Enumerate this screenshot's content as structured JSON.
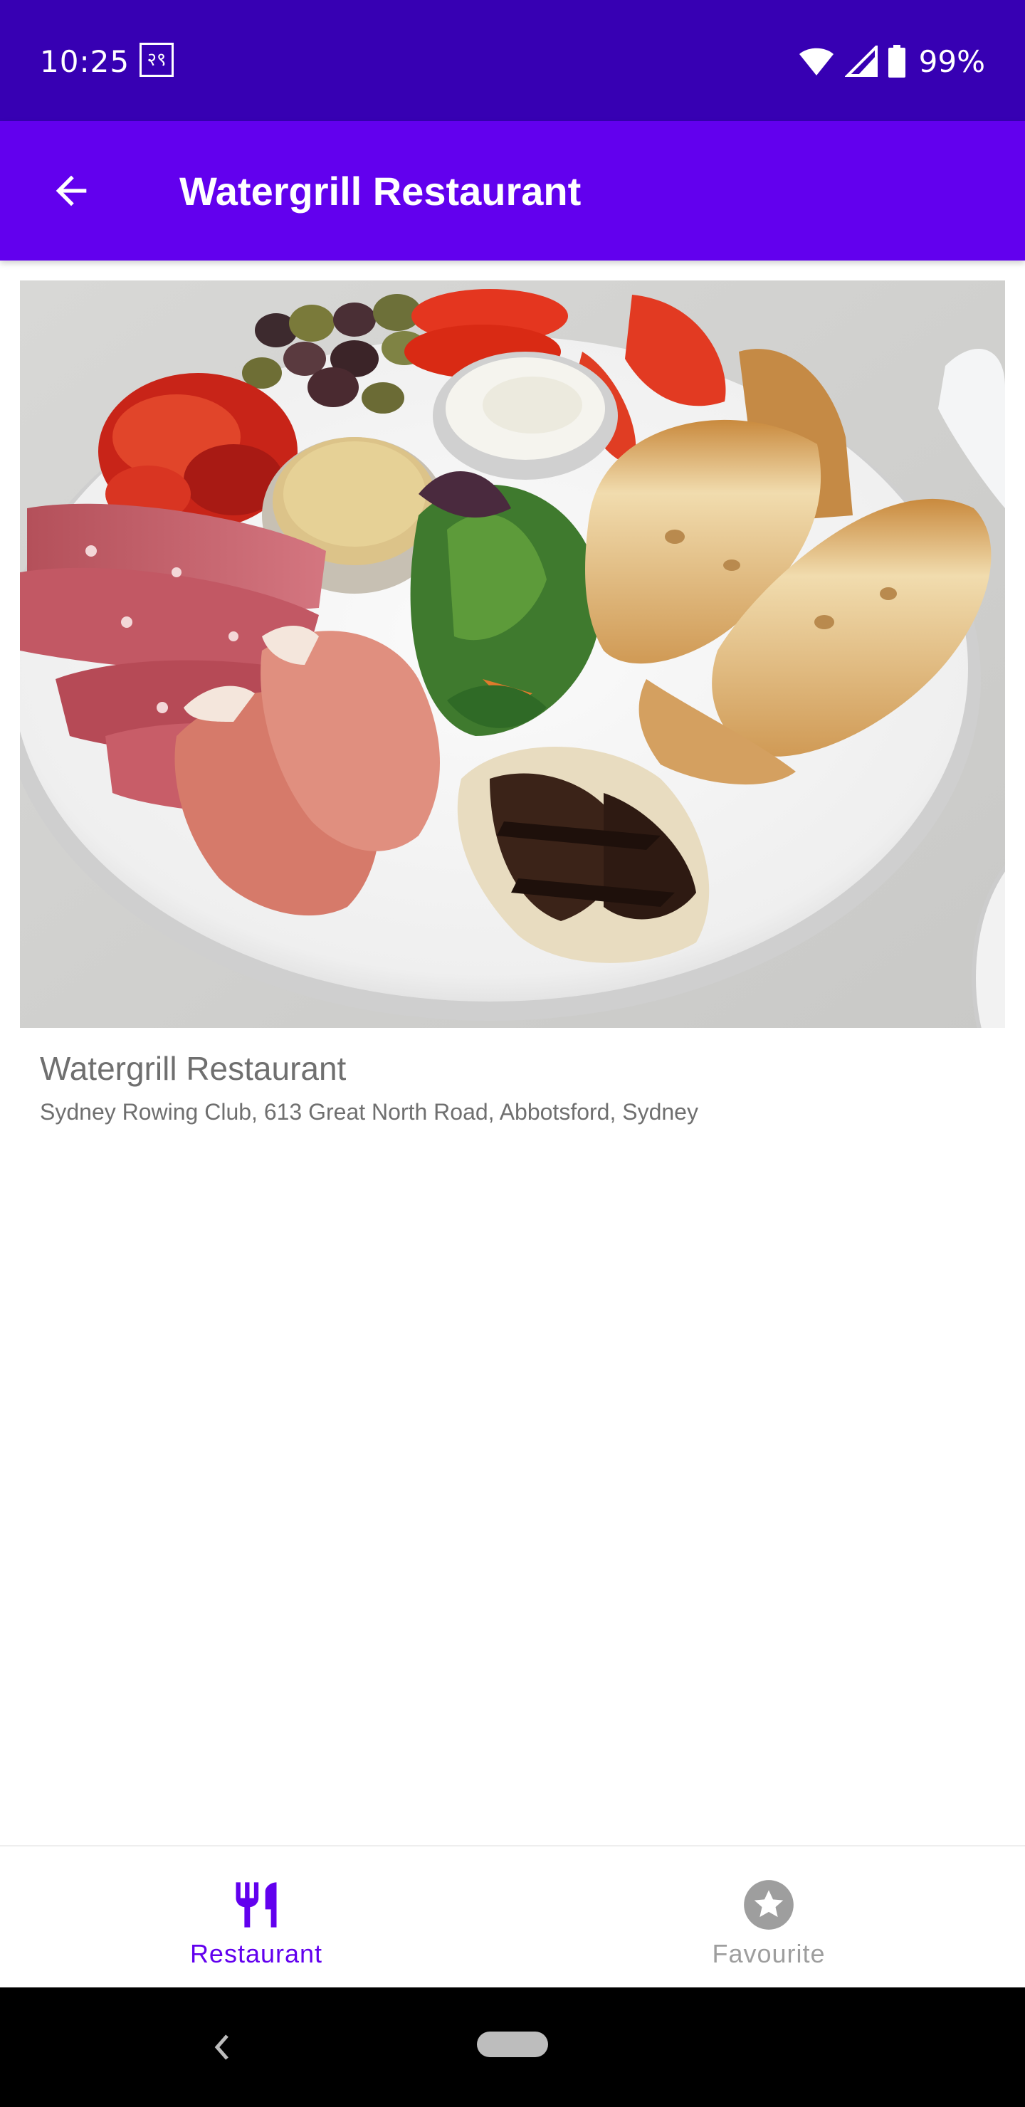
{
  "status_bar": {
    "time": "10:25",
    "notification_glyph": "२९",
    "battery_percent": "99%",
    "icons": [
      "wifi-icon",
      "signal-icon",
      "battery-icon"
    ]
  },
  "app_bar": {
    "title": "Watergrill Restaurant",
    "back_icon": "arrow-back-icon"
  },
  "restaurant": {
    "name": "Watergrill Restaurant",
    "address": "Sydney Rowing Club, 613 Great North Road, Abbotsford, Sydney",
    "image_subject": "antipasto platter"
  },
  "bottom_nav": {
    "items": [
      {
        "label": "Restaurant",
        "icon": "fork-knife-icon",
        "active": true
      },
      {
        "label": "Favourite",
        "icon": "star-icon",
        "active": false
      }
    ]
  },
  "colors": {
    "status_bar": "#3700b3",
    "app_bar": "#6200ee",
    "accent": "#6200ee",
    "inactive": "#9e9e9e",
    "text_secondary": "#6f6f6f"
  }
}
